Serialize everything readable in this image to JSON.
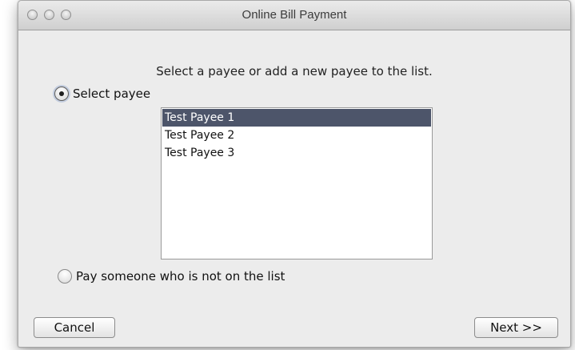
{
  "window": {
    "title": "Online Bill Payment"
  },
  "main": {
    "instruction": "Select a payee or add a new payee to the list.",
    "select_payee_label": "Select payee",
    "select_payee_selected": true,
    "payees": [
      {
        "label": "Test Payee 1",
        "selected": true
      },
      {
        "label": "Test Payee 2",
        "selected": false
      },
      {
        "label": "Test Payee 3",
        "selected": false
      }
    ],
    "other_payee_label": "Pay someone who is not on the list",
    "other_payee_selected": false
  },
  "footer": {
    "cancel_label": "Cancel",
    "next_label": "Next >>"
  },
  "colors": {
    "selection_bg": "#4d556a",
    "window_bg": "#ececec"
  }
}
